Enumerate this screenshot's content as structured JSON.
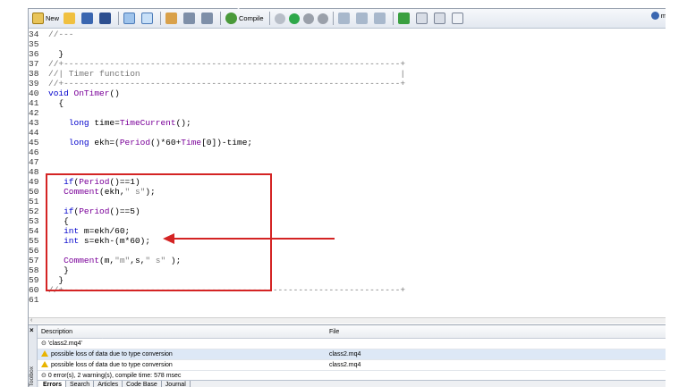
{
  "toolbar": {
    "new_label": "New",
    "compile_label": "Compile",
    "right_label": "m"
  },
  "editor": {
    "lines": [
      {
        "n": "34",
        "text": "//---"
      },
      {
        "n": "35",
        "text": ""
      },
      {
        "n": "36",
        "text": "  }"
      },
      {
        "n": "37",
        "text": "//+------------------------------------------------------------------+"
      },
      {
        "n": "38",
        "text": "//| Timer function                                                   |"
      },
      {
        "n": "39",
        "text": "//+------------------------------------------------------------------+"
      },
      {
        "n": "40",
        "text": "void OnTimer()"
      },
      {
        "n": "41",
        "text": "  {"
      },
      {
        "n": "42",
        "text": ""
      },
      {
        "n": "43",
        "text": "    long time=TimeCurrent();"
      },
      {
        "n": "44",
        "text": ""
      },
      {
        "n": "45",
        "text": "    long ekh=(Period()*60+Time[0])-time;"
      },
      {
        "n": "46",
        "text": ""
      },
      {
        "n": "47",
        "text": ""
      },
      {
        "n": "48",
        "text": ""
      },
      {
        "n": "49",
        "text": "   if(Period()==1)"
      },
      {
        "n": "50",
        "text": "   Comment(ekh,\" s\");"
      },
      {
        "n": "51",
        "text": ""
      },
      {
        "n": "52",
        "text": "   if(Period()==5)"
      },
      {
        "n": "53",
        "text": "   {"
      },
      {
        "n": "54",
        "text": "   int m=ekh/60;"
      },
      {
        "n": "55",
        "text": "   int s=ekh-(m*60);"
      },
      {
        "n": "56",
        "text": ""
      },
      {
        "n": "57",
        "text": "   Comment(m,\"m\",s,\" s\" );"
      },
      {
        "n": "58",
        "text": "   }"
      },
      {
        "n": "59",
        "text": "  }"
      },
      {
        "n": "60",
        "text": "//+------------------------------------------------------------------+"
      },
      {
        "n": "61",
        "text": ""
      }
    ]
  },
  "toolbox": {
    "columns": {
      "description": "Description",
      "file": "File"
    },
    "rows": [
      {
        "description": "'class2.mq4'",
        "file": "",
        "type": "info"
      },
      {
        "description": "possible loss of data due to type conversion",
        "file": "class2.mq4",
        "type": "warning"
      },
      {
        "description": "possible loss of data due to type conversion",
        "file": "class2.mq4",
        "type": "warning"
      },
      {
        "description": "0 error(s), 2 warning(s), compile time: 578 msec",
        "file": "",
        "type": "info"
      }
    ],
    "side_label": "Toolbox",
    "tabs": [
      "Errors",
      "Search",
      "Articles",
      "Code Base",
      "Journal"
    ]
  },
  "colors": {
    "annotation_red": "#d42424",
    "keyword_blue": "#0000cc",
    "function_purple": "#7a0099"
  }
}
